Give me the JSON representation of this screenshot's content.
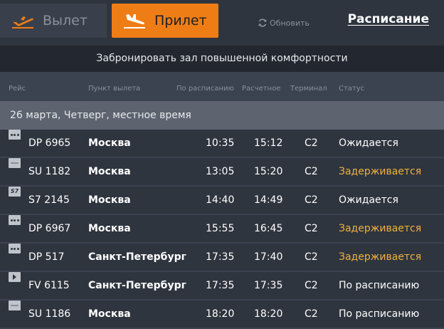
{
  "tabs": {
    "departure_label": "Вылет",
    "arrival_label": "Прилет",
    "active": "arrival"
  },
  "refresh_label": "Обновить",
  "schedule_link": "Расписание",
  "banner_text": "Забронировать зал повышенной комфортности",
  "columns": {
    "flight": "Рейс",
    "origin": "Пункт вылета",
    "scheduled": "По расписанию",
    "estimated": "Расчетное",
    "terminal": "Терминал",
    "status": "Статус"
  },
  "date_band": "26 марта, Четверг, местное время",
  "flights": [
    {
      "airline_logo": "pobeda-dots-logo",
      "flight": "DP 6965",
      "city": "Москва",
      "scheduled": "10:35",
      "estimated": "15:12",
      "terminal": "C2",
      "status": "Ожидается",
      "status_type": "normal"
    },
    {
      "airline_logo": "aeroflot-logo",
      "flight": "SU 1182",
      "city": "Москва",
      "scheduled": "13:05",
      "estimated": "15:20",
      "terminal": "C2",
      "status": "Задерживается",
      "status_type": "delayed"
    },
    {
      "airline_logo": "s7-logo",
      "flight": "S7 2145",
      "city": "Москва",
      "scheduled": "14:40",
      "estimated": "14:49",
      "terminal": "C2",
      "status": "Ожидается",
      "status_type": "normal"
    },
    {
      "airline_logo": "pobeda-dots-logo",
      "flight": "DP 6967",
      "city": "Москва",
      "scheduled": "15:55",
      "estimated": "16:45",
      "terminal": "C2",
      "status": "Задерживается",
      "status_type": "delayed"
    },
    {
      "airline_logo": "pobeda-dots-logo",
      "flight": "DP 517",
      "city": "Санкт-Петербург",
      "scheduled": "17:35",
      "estimated": "17:40",
      "terminal": "C2",
      "status": "Задерживается",
      "status_type": "delayed"
    },
    {
      "airline_logo": "rossiya-logo",
      "flight": "FV 6115",
      "city": "Санкт-Петербург",
      "scheduled": "17:35",
      "estimated": "17:35",
      "terminal": "C2",
      "status": "По расписанию",
      "status_type": "normal"
    },
    {
      "airline_logo": "aeroflot-logo",
      "flight": "SU 1186",
      "city": "Москва",
      "scheduled": "18:20",
      "estimated": "18:20",
      "terminal": "C2",
      "status": "По расписанию",
      "status_type": "normal"
    }
  ],
  "colors": {
    "accent": "#ef7d16",
    "delayed": "#f0b13d",
    "row_bg": "#2f353f",
    "page_bg": "#3b4250"
  }
}
